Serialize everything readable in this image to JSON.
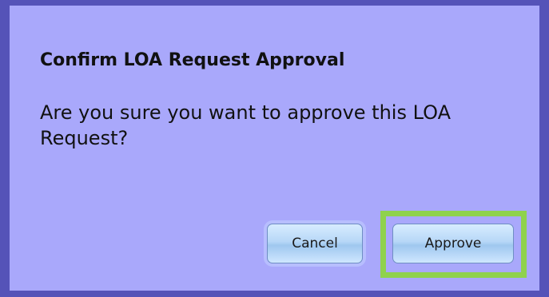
{
  "dialog": {
    "title": "Confirm LOA Request Approval",
    "message": "Are you sure you want to approve this LOA Request?",
    "buttons": {
      "cancel_label": "Cancel",
      "approve_label": "Approve"
    },
    "colors": {
      "background": "#a9a8fb",
      "border": "#5553b8",
      "highlight": "#8fd24d"
    }
  }
}
